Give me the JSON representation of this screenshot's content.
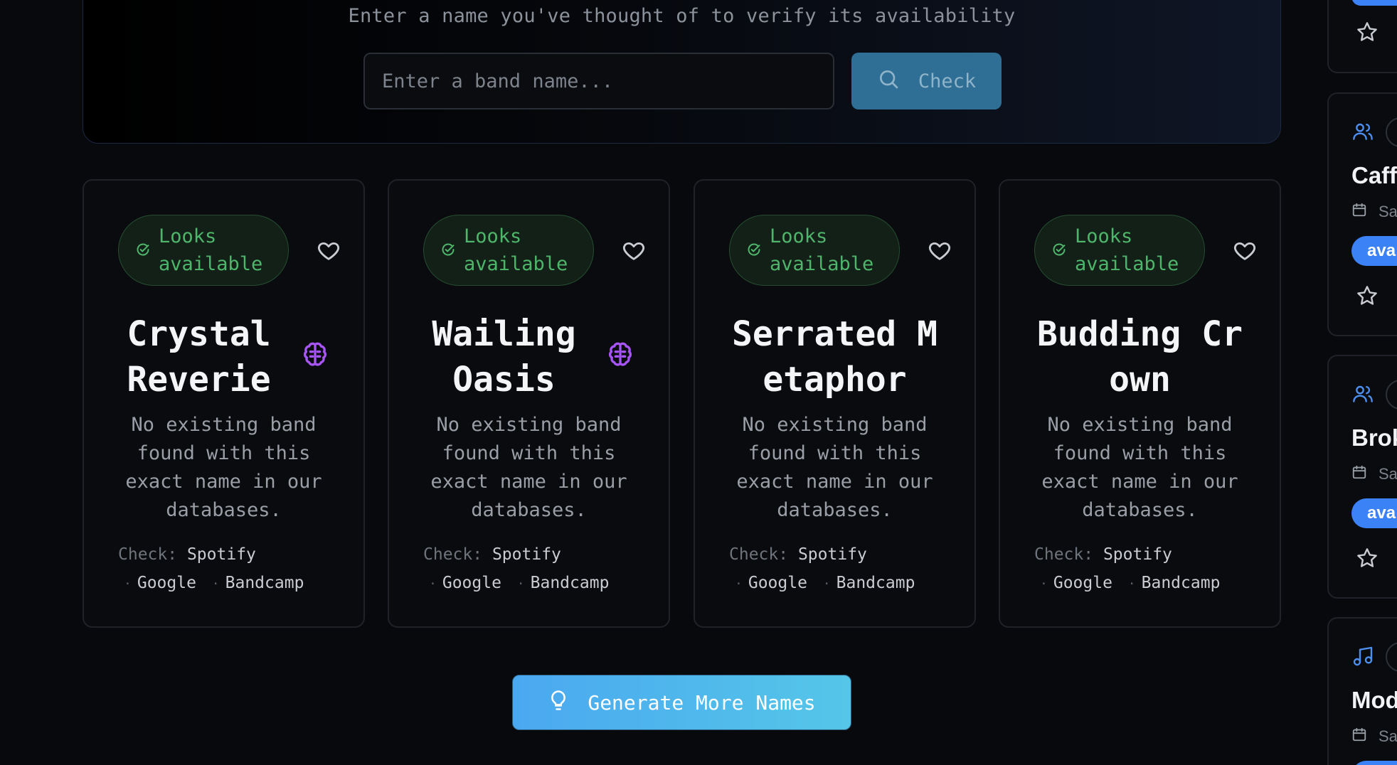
{
  "checker": {
    "subtitle": "Enter a name you've thought of to verify its availability",
    "input_placeholder": "Enter a band name...",
    "input_value": "",
    "check_label": "Check"
  },
  "cards": [
    {
      "status": "Looks available",
      "name": "Crystal Reverie",
      "ai": true,
      "description": "No existing band found with this exact name in our databases.",
      "check_label": "Check:",
      "links": [
        "Spotify",
        "Google",
        "Bandcamp"
      ]
    },
    {
      "status": "Looks available",
      "name": "Wailing Oasis",
      "ai": true,
      "description": "No existing band found with this exact name in our databases.",
      "check_label": "Check:",
      "links": [
        "Spotify",
        "Google",
        "Bandcamp"
      ]
    },
    {
      "status": "Looks available",
      "name": "Serrated Metaphor",
      "ai": false,
      "description": "No existing band found with this exact name in our databases.",
      "check_label": "Check:",
      "links": [
        "Spotify",
        "Google",
        "Bandcamp"
      ]
    },
    {
      "status": "Looks available",
      "name": "Budding Crown",
      "ai": false,
      "description": "No existing band found with this exact name in our databases.",
      "check_label": "Check:",
      "links": [
        "Spotify",
        "Google",
        "Bandcamp"
      ]
    }
  ],
  "generate_label": "Generate More Names",
  "rail": {
    "items": [
      {
        "icon": "users-icon",
        "title": "Caff",
        "date": "Sa",
        "pill": "ava"
      },
      {
        "icon": "users-icon",
        "title": "Brok",
        "date": "Sa",
        "pill": "ava"
      },
      {
        "icon": "music-icon",
        "title": "Mode",
        "date": "Sa"
      }
    ]
  },
  "colors": {
    "available_green": "#4fb56b",
    "accent_blue": "#3b82f6",
    "brain_purple": "#a855f7",
    "generate_gradient": [
      "#4aa8f0",
      "#55c6e8"
    ]
  }
}
